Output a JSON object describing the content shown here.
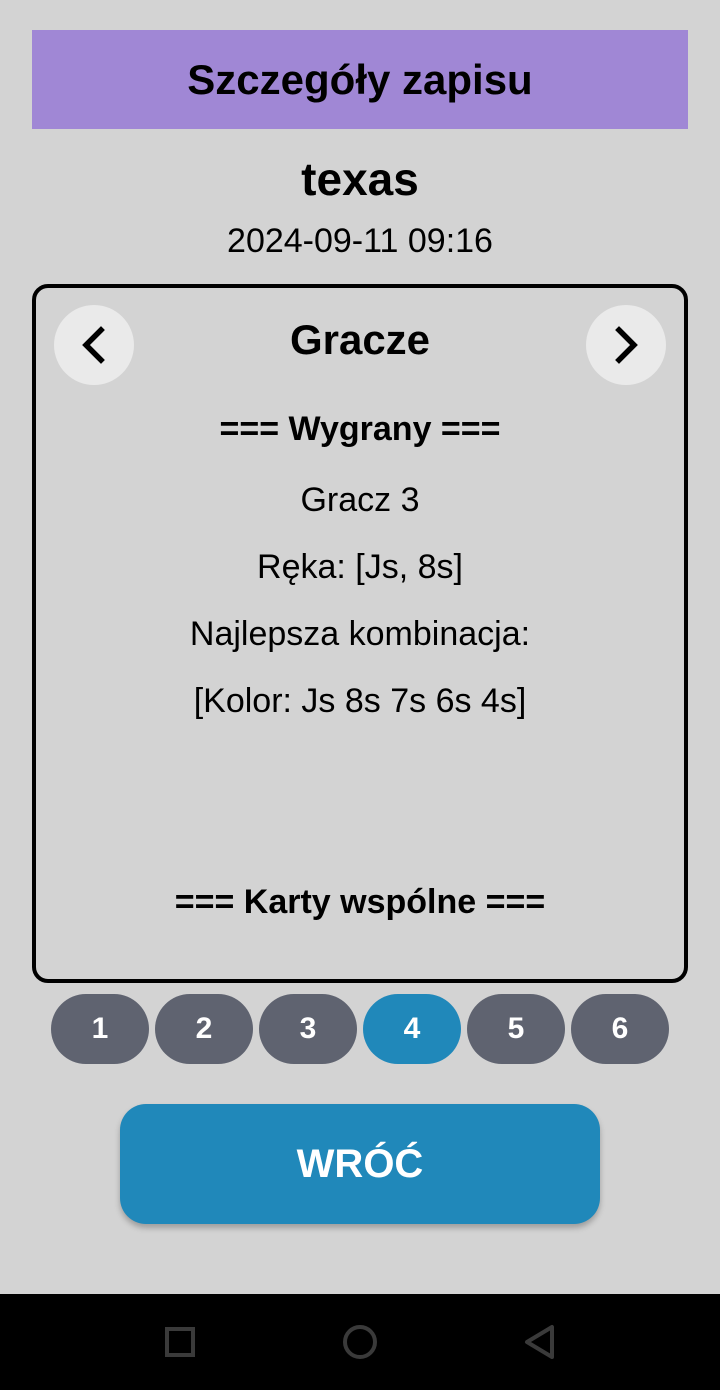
{
  "header": {
    "title": "Szczegóły zapisu"
  },
  "record": {
    "name": "texas",
    "date": "2024-09-11 09:16"
  },
  "panel": {
    "title": "Gracze",
    "winner_heading": "=== Wygrany ===",
    "lines": [
      "Gracz 3",
      "Ręka: [Js, 8s]",
      "Najlepsza kombinacja:",
      "[Kolor: Js 8s 7s 6s 4s]"
    ],
    "community_heading": "=== Karty wspólne ==="
  },
  "pager": {
    "pages": [
      "1",
      "2",
      "3",
      "4",
      "5",
      "6"
    ],
    "active_page": "4"
  },
  "back_button": {
    "label": "WRÓĆ"
  },
  "icons": {
    "prev": "chevron-left-icon",
    "next": "chevron-right-icon",
    "recent": "square-icon",
    "home": "circle-icon",
    "back": "triangle-back-icon"
  },
  "colors": {
    "header_bg": "#a087d5",
    "page_bg": "#d3d3d3",
    "page_btn": "#5f6370",
    "accent": "#2088ba",
    "nav_bar": "#000000"
  }
}
